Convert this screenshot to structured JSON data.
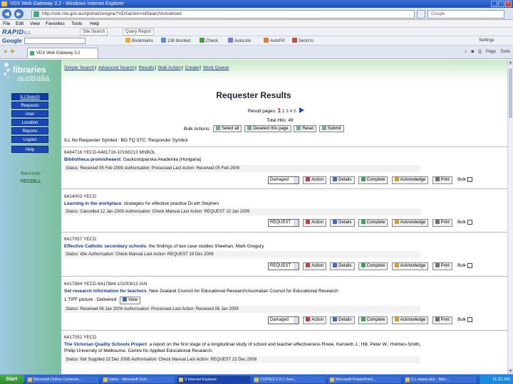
{
  "window": {
    "title": "VDX Web Gateway 3.2 - Windows Internet Explorer"
  },
  "address": {
    "url": "http://vdx.nla.gov.au/zportal/zengine?VDXaction=IllSearchAdvanced",
    "search_placeholder": "Google"
  },
  "menubar": [
    "File",
    "Edit",
    "View",
    "Favorites",
    "Tools",
    "Help"
  ],
  "toolbar1": {
    "brand": "RAPID",
    "brand_suffix": "ILL",
    "items": [
      "Site Search",
      "Query Report"
    ]
  },
  "toolbar2": {
    "brand": "Google",
    "items": [
      "Bookmarks",
      "138 blocked",
      "Check",
      "AutoLink",
      "AutoFill",
      "Send to",
      "Settings"
    ]
  },
  "tab": {
    "label": "VDX Web Gateway 3.2",
    "commands": [
      "Page",
      "Tools"
    ]
  },
  "sidebar": {
    "logo_line1": "libraries",
    "logo_line2": "australia",
    "nav": [
      "ILLSearch",
      "Requests",
      "User",
      "Location",
      "Reports",
      "Logout",
      "Help"
    ],
    "barcode_label": "Barcode",
    "barcode_value": "YECDILL"
  },
  "toplinks": [
    "Simple Search",
    "Advanced Search",
    "Results",
    "Bulk Action",
    "Create",
    "Work Queue"
  ],
  "page": {
    "title": "Requester Results",
    "pages_label": "Result pages:",
    "current_page": "1",
    "other_pages": "2 3 4 5",
    "total": "Total Hits: 49"
  },
  "bulk": {
    "label": "Bulk Actions:",
    "buttons": [
      "Select all",
      "Deselect this page",
      "Reset",
      "Submit"
    ]
  },
  "ill_header": "ILL No:Requester Symbol : BG TQ STC: Responder Symbol",
  "records": [
    {
      "id": "6484716 YECD-6481716-10168213 MNBOL",
      "title_bold": "Bibliotheca promisheaest",
      "title_rest": ": Gaskostoparska Akademia (Hungaria)",
      "status_prefix": "Status:",
      "status": "Received 05 Feb 2009",
      "status_auth_label": "Authorisation:",
      "status_auth": "Processed",
      "status_last_label": "Last Action:",
      "status_last": "Received 05 Feb 2009",
      "select": "Damaged",
      "action": "Action",
      "details": "Details",
      "complete": "Complete",
      "acknowledge": "Acknowledge",
      "print": "Print",
      "bulk": "Bulk"
    },
    {
      "id": "6414003 YECD",
      "title_bold": "Learning in the workplace",
      "title_rest": ": strategies for effective practice DI eth Stephen",
      "status_prefix": "Status:",
      "status": "Cancelled 12 Jan 2009",
      "status_auth_label": "Authorisation:",
      "status_auth": "Check Manual",
      "status_last_label": "Last Action:",
      "status_last": "REQUEST 12 Jan 2009",
      "select": "REQUEST",
      "action": "Action",
      "details": "Details",
      "complete": "Complete",
      "acknowledge": "Acknowledge",
      "print": "Print",
      "bulk": "Bulk"
    },
    {
      "id": "6417057 YECD",
      "title_bold": "Effective Catholic secondary schools",
      "title_rest": ": the findings of two case studies Sheehan, Mark Gregory",
      "status_prefix": "Status:",
      "status": "Idle",
      "status_auth_label": "Authorisation:",
      "status_auth": "Check Manual",
      "status_last_label": "Last Action:",
      "status_last": "REQUEST 19 Dec 2008",
      "select": "REQUEST",
      "action": "Action",
      "details": "Details",
      "complete": "Complete",
      "acknowledge": "Acknowledge",
      "print": "Print",
      "bulk": "Bulk"
    },
    {
      "id": "6417884 YECD-6417884-10200813 IAN",
      "title_bold": "Set research information for teachers",
      "title_rest": ": New Zealand Council for Educational Research/Australian Council for Educational Research",
      "tiff_label": "1 TIFF picture : Delivered",
      "tiff_view": "View",
      "status_prefix": "Status:",
      "status": "Received 06 Jan 2009",
      "status_auth_label": "Authorisation:",
      "status_auth": "Processed",
      "status_last_label": "Last Action:",
      "status_last": "Received 06 Jan 2009",
      "select": "Damaged",
      "action": "Action",
      "details": "Details",
      "complete": "Complete",
      "acknowledge": "Acknowledge",
      "print": "Print",
      "bulk": "Bulk"
    },
    {
      "id": "6417052 YECD",
      "title_bold": "The Victorian Quality Schools Project",
      "title_rest": ": a report on the first stage of a longitudinal study of school and teacher effectiveness Rowe, Kenneth J.; Hill, Peter W.; Holmes-Smith,",
      "title_line2": "Philip University of Melbourne. Centre for Applied Educational Research.",
      "status_prefix": "Status:",
      "status": "Not Supplied 22 Dec 2008",
      "status_auth_label": "Authorisation:",
      "status_auth": "Check Manual",
      "status_last_label": "Last Action:",
      "status_last": "REQUEST 22 Dec 2008"
    }
  ],
  "taskbar": {
    "start": "Start",
    "tasks": [
      "Microsoft Online Commun...",
      "Inbox - Microsoft Outl...",
      "3 Internet Explorer",
      "COPIES 2.0.1 Serv...",
      "Microsoft PowerPoint...",
      "ILL report.doc - Micr..."
    ],
    "clock": "11:32 AM"
  },
  "colors": {
    "link": "#12349a",
    "nav_button": "#1a48b8",
    "sidebar_green": "#7cc09c",
    "sidebar_blue": "#9cc8e0"
  }
}
